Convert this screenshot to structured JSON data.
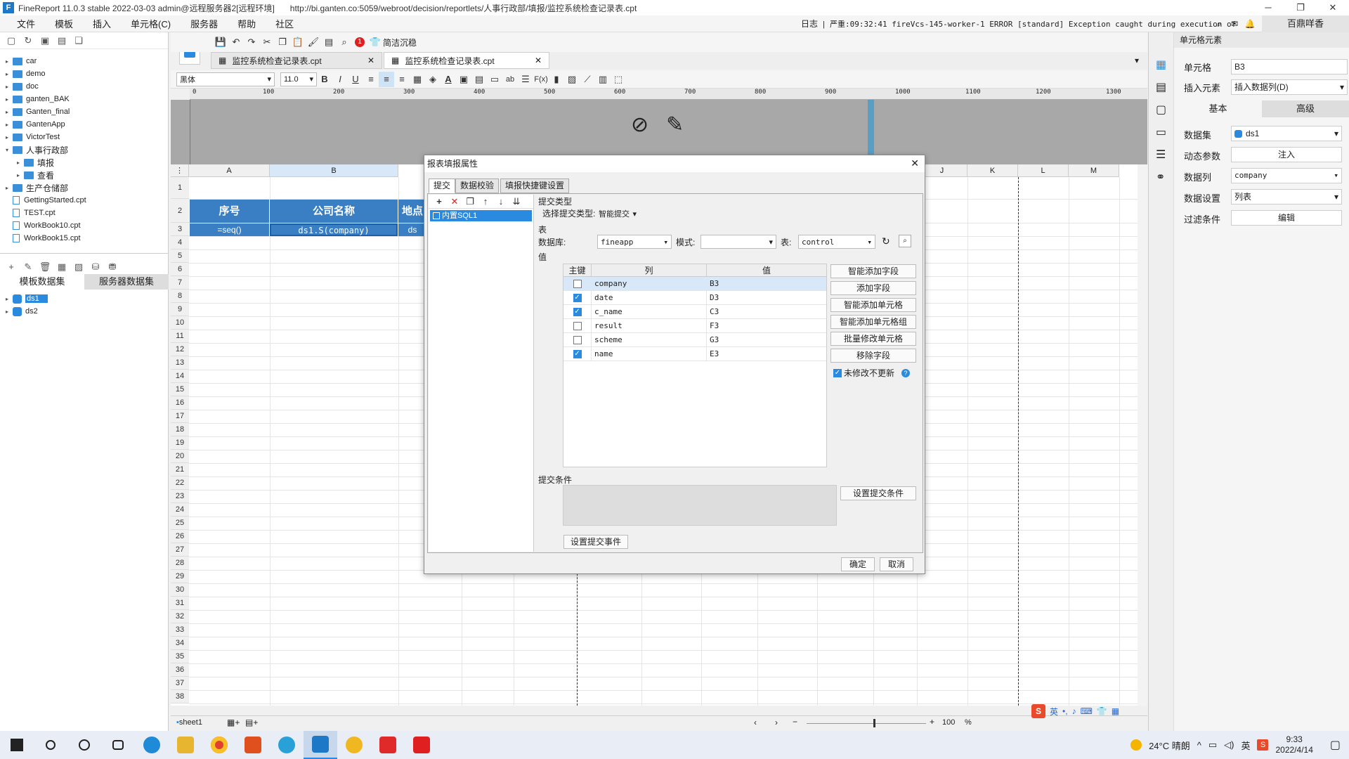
{
  "window": {
    "title": "FineReport 11.0.3 stable 2022-03-03 admin@远程服务器2[远程环境]",
    "url": "http://bi.ganten.co:5059/webroot/decision/reportlets/人事行政部/填报/监控系统检查记录表.cpt"
  },
  "menu": [
    "文件",
    "模板",
    "插入",
    "单元格(C)",
    "服务器",
    "帮助",
    "社区"
  ],
  "log": {
    "label": "日志",
    "text": "严重:09:32:41 fireVcs-145-worker-1 ERROR [standard] Exception caught during execution of a..."
  },
  "user": "百鼎咩香",
  "tree": [
    {
      "label": "car",
      "type": "folder"
    },
    {
      "label": "demo",
      "type": "folder"
    },
    {
      "label": "doc",
      "type": "folder"
    },
    {
      "label": "ganten_BAK",
      "type": "folder"
    },
    {
      "label": "Ganten_final",
      "type": "folder"
    },
    {
      "label": "GantenApp",
      "type": "folder"
    },
    {
      "label": "VictorTest",
      "type": "folder"
    },
    {
      "label": "人事行政部",
      "type": "folder-open"
    },
    {
      "label": "填报",
      "type": "subfolder"
    },
    {
      "label": "查看",
      "type": "subfolder"
    },
    {
      "label": "生产仓储部",
      "type": "folder"
    },
    {
      "label": "GettingStarted.cpt",
      "type": "file"
    },
    {
      "label": "TEST.cpt",
      "type": "file"
    },
    {
      "label": "WorkBook10.cpt",
      "type": "file"
    },
    {
      "label": "WorkBook15.cpt",
      "type": "file"
    }
  ],
  "dataset_tabs": [
    "模板数据集",
    "服务器数据集"
  ],
  "datasets": [
    "ds1",
    "ds2"
  ],
  "toolbar": {
    "clean": "简洁沉稳",
    "badge": "1"
  },
  "tabs": [
    "监控系统检查记录表.cpt",
    "监控系统检查记录表.cpt"
  ],
  "font": {
    "name": "黑体",
    "size": "11.0"
  },
  "ruler": [
    "0",
    "100",
    "200",
    "300",
    "400",
    "500",
    "600",
    "700",
    "800",
    "900",
    "1000",
    "1100",
    "1200",
    "1300"
  ],
  "columns": [
    "A",
    "B",
    "J",
    "K",
    "L",
    "M"
  ],
  "rows": [
    "1",
    "2",
    "3",
    "4",
    "5",
    "6",
    "7",
    "8",
    "9",
    "10",
    "11",
    "12",
    "13",
    "14",
    "15",
    "16",
    "17",
    "18",
    "19",
    "20",
    "21",
    "22",
    "23",
    "24",
    "25",
    "26",
    "27",
    "28",
    "29",
    "30",
    "31",
    "32",
    "33",
    "34",
    "35",
    "36",
    "37",
    "38"
  ],
  "cells": {
    "a2": "序号",
    "b2": "公司名称",
    "c2": "地点",
    "a3": "=seq()",
    "b3": "ds1.S(company)",
    "c3": "ds"
  },
  "sheet": {
    "name": "sheet1",
    "zoom": "100"
  },
  "right": {
    "title": "单元格元素",
    "cell_label": "单元格",
    "cell_value": "B3",
    "insert_label": "插入元素",
    "insert_value": "插入数据列(D)",
    "tab_basic": "基本",
    "tab_adv": "高级",
    "ds_label": "数据集",
    "ds_value": "ds1",
    "param_label": "动态参数",
    "param_value": "注入",
    "col_label": "数据列",
    "col_value": "company",
    "set_label": "数据设置",
    "set_value": "列表",
    "filter_label": "过滤条件",
    "filter_value": "编辑"
  },
  "dialog": {
    "title": "报表填报属性",
    "tabs": [
      "提交",
      "数据校验",
      "填报快捷键设置"
    ],
    "list_item": "内置SQL1",
    "submit_type_label": "提交类型",
    "select_type_label": "选择提交类型:",
    "select_type_value": "智能提交",
    "table_label": "表",
    "db_label": "数据库:",
    "db_value": "fineapp",
    "mode_label": "模式:",
    "mode_value": "",
    "tbl_label": "表:",
    "tbl_value": "control",
    "value_label": "值",
    "headers": [
      "主键",
      "列",
      "值"
    ],
    "rows": [
      {
        "col": "company",
        "val": "B3",
        "checked": false
      },
      {
        "col": "date",
        "val": "D3",
        "checked": true
      },
      {
        "col": "c_name",
        "val": "C3",
        "checked": true
      },
      {
        "col": "result",
        "val": "F3",
        "checked": false
      },
      {
        "col": "scheme",
        "val": "G3",
        "checked": false
      },
      {
        "col": "name",
        "val": "E3",
        "checked": true
      }
    ],
    "side_buttons": [
      "智能添加字段",
      "添加字段",
      "智能添加单元格",
      "智能添加单元格组",
      "批量修改单元格",
      "移除字段"
    ],
    "unchanged_label": "未修改不更新",
    "cond_label": "提交条件",
    "cond_button": "设置提交条件",
    "event_button": "设置提交事件",
    "ok": "确定",
    "cancel": "取消"
  },
  "taskbar": {
    "weather": "24°C 晴朗",
    "time": "9:33",
    "date": "2022/4/14",
    "ime": "英"
  }
}
